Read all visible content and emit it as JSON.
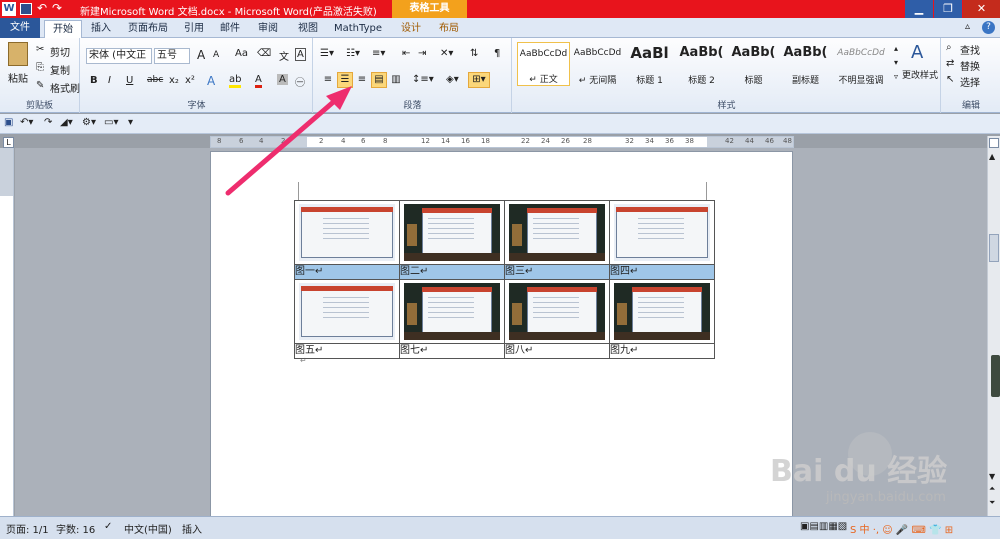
{
  "window": {
    "title": "新建Microsoft Word 文档.docx - Microsoft Word(产品激活失败)",
    "contextual_tab_group": "表格工具",
    "app_icon": "W"
  },
  "tabs": [
    "文件",
    "开始",
    "插入",
    "页面布局",
    "引用",
    "邮件",
    "审阅",
    "视图",
    "MathType",
    "设计",
    "布局"
  ],
  "ribbon": {
    "clipboard": {
      "paste": "粘贴",
      "cut": "剪切",
      "copy": "复制",
      "format_painter": "格式刷",
      "label": "剪贴板"
    },
    "font": {
      "font_name": "宋体 (中文正",
      "font_size": "五号",
      "label": "字体",
      "grow": "A",
      "shrink": "A",
      "case": "Aa",
      "bold": "B",
      "italic": "I",
      "underline": "U",
      "strike": "abc",
      "sub": "x₂",
      "sup": "x²"
    },
    "paragraph": {
      "label": "段落"
    },
    "styles": {
      "label": "样式",
      "items": [
        {
          "sample": "AaBbCcDd",
          "name": "↵ 正文"
        },
        {
          "sample": "AaBbCcDd",
          "name": "↵ 无间隔"
        },
        {
          "sample": "AaBl",
          "name": "标题 1"
        },
        {
          "sample": "AaBb(",
          "name": "标题 2"
        },
        {
          "sample": "AaBb(",
          "name": "标题"
        },
        {
          "sample": "AaBb(",
          "name": "副标题"
        },
        {
          "sample": "AaBbCcDd",
          "name": "不明显强调"
        }
      ],
      "change_styles": "更改样式"
    },
    "editing": {
      "find": "查找",
      "replace": "替换",
      "select": "选择",
      "label": "编辑"
    }
  },
  "ruler_ticks": [
    "8",
    "6",
    "4",
    "2",
    "2",
    "4",
    "6",
    "8",
    "12",
    "14",
    "16",
    "18",
    "22",
    "24",
    "26",
    "28",
    "32",
    "34",
    "36",
    "38",
    "42",
    "44",
    "46",
    "48"
  ],
  "table": {
    "captions_row1": [
      "图一↵",
      "图二↵",
      "图三↵",
      "图四↵"
    ],
    "captions_row2": [
      "图五↵",
      "图七↵",
      "图八↵",
      "图九↵"
    ]
  },
  "status": {
    "page": "页面: 1/1",
    "words": "字数: 16",
    "language": "中文(中国)",
    "mode": "插入",
    "ime": "S 中 ·, ☺ 🎤 ⌨ 👕 ⊞"
  },
  "watermark": {
    "text": "Bai du 经验",
    "url": "jingyan.baidu.com"
  },
  "colors": {
    "title_bar": "#e8141c",
    "contextual": "#f3a11c",
    "file_tab": "#2b579a",
    "highlight": "#fbd77a",
    "caption_row": "#9fc6e8",
    "arrow": "#ee2d6e"
  }
}
